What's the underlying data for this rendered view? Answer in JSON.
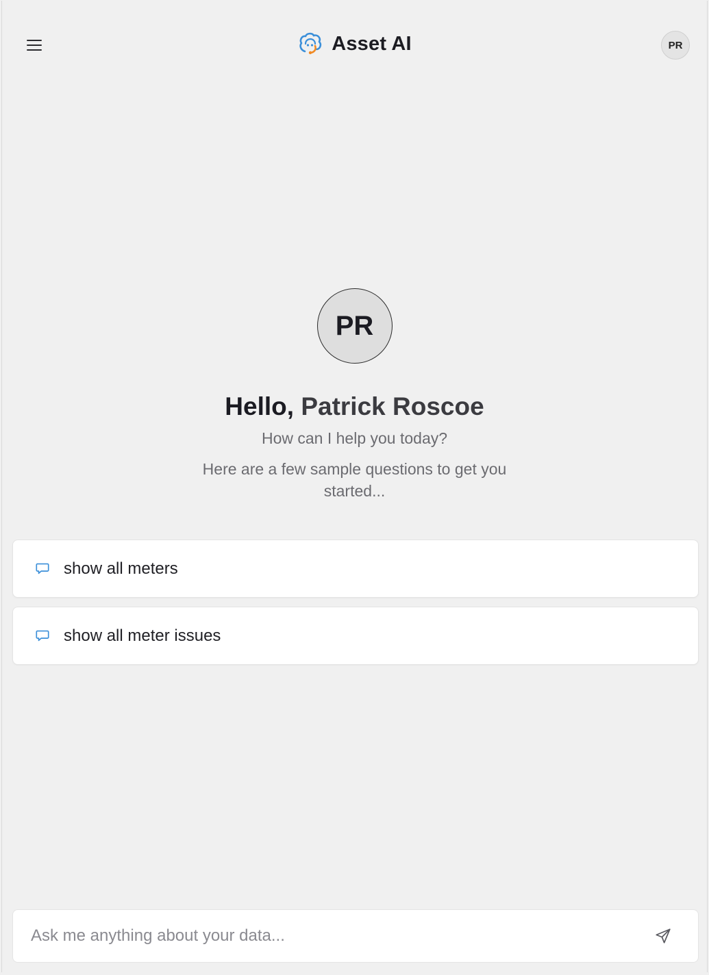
{
  "header": {
    "title": "Asset AI",
    "avatar_initials": "PR",
    "menu_icon": "hamburger-menu-icon",
    "logo_icon": "brain-headset-logo-icon"
  },
  "welcome": {
    "avatar_initials": "PR",
    "greeting_prefix": "Hello,",
    "user_name": "Patrick Roscoe",
    "subtitle": "How can I help you today?",
    "sample_hint": "Here are a few sample questions to get you started..."
  },
  "suggestions": [
    {
      "icon": "chat-bubble-icon",
      "label": "show all meters"
    },
    {
      "icon": "chat-bubble-icon",
      "label": "show all meter issues"
    }
  ],
  "composer": {
    "placeholder": "Ask me anything about your data...",
    "value": "",
    "send_icon": "send-paper-plane-icon"
  },
  "colors": {
    "background": "#f0f0f0",
    "card": "#ffffff",
    "accent_blue": "#3b8fd9",
    "accent_orange": "#f08a24",
    "text_primary": "#1f1f24",
    "text_muted": "#6b6b70"
  }
}
